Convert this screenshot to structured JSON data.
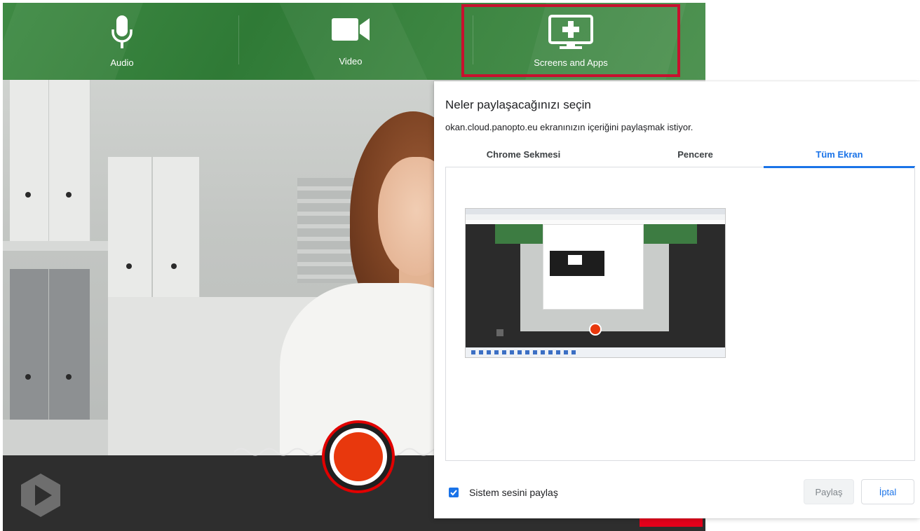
{
  "recorder": {
    "sources": [
      {
        "label": "Audio",
        "icon": "microphone-icon"
      },
      {
        "label": "Video",
        "icon": "video-camera-icon"
      },
      {
        "label": "Screens and Apps",
        "icon": "screen-plus-icon"
      }
    ],
    "highlight_color": "#c8102e",
    "record_button_color": "#e8380d",
    "logo": "panopto-logo-icon"
  },
  "dialog": {
    "title": "Neler paylaşacağınızı seçin",
    "subtitle": "okan.cloud.panopto.eu ekranınızın içeriğini paylaşmak istiyor.",
    "tabs": [
      {
        "label": "Chrome Sekmesi",
        "active": false
      },
      {
        "label": "Pencere",
        "active": false
      },
      {
        "label": "Tüm Ekran",
        "active": true
      }
    ],
    "preview": "screen-thumbnail",
    "system_audio_label": "Sistem sesini paylaş",
    "system_audio_checked": true,
    "share_label": "Paylaş",
    "cancel_label": "İptal",
    "accent_color": "#1a73e8"
  }
}
